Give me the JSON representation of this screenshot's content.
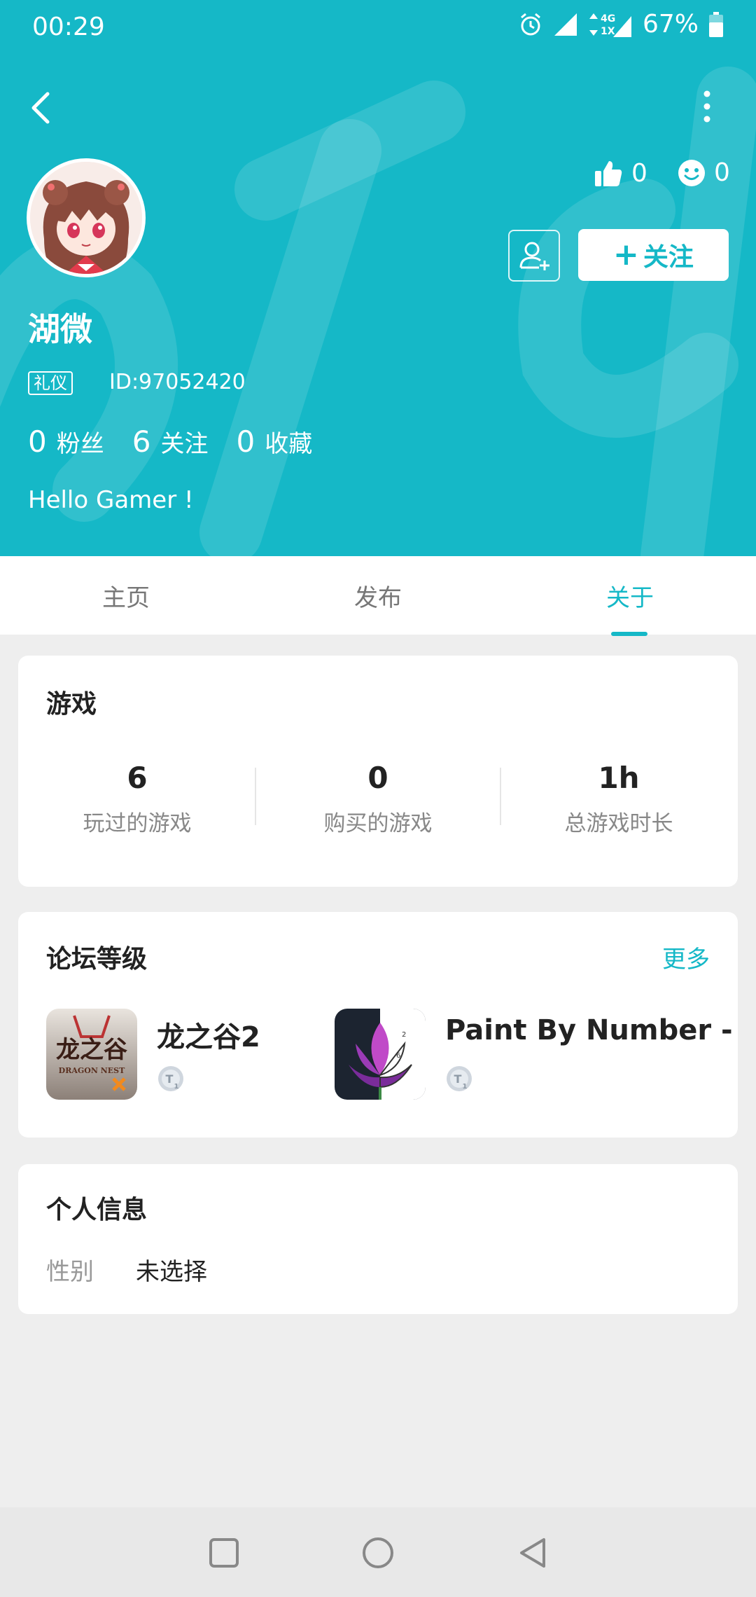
{
  "status_bar": {
    "time": "00:29",
    "network": "4G 1X",
    "battery": "67%",
    "icons": [
      "alarm-icon",
      "signal-icon",
      "network-icon",
      "battery-icon"
    ]
  },
  "colors": {
    "accent": "#15b8c7",
    "header_bg": "#15b8c7",
    "page_bg": "#eeeeee"
  },
  "header": {
    "back_icon": "back-arrow-icon",
    "more_icon": "more-vertical-icon",
    "likes": "0",
    "smiles": "0",
    "follow_label": "关注",
    "username": "湖微",
    "badge": "礼仪",
    "user_id": "ID:97052420",
    "counts": [
      {
        "num": "0",
        "label": "粉丝"
      },
      {
        "num": "6",
        "label": "关注"
      },
      {
        "num": "0",
        "label": "收藏"
      }
    ],
    "bio": "Hello Gamer !"
  },
  "tabs": [
    {
      "label": "主页",
      "active": false
    },
    {
      "label": "发布",
      "active": false
    },
    {
      "label": "关于",
      "active": true
    }
  ],
  "games": {
    "title": "游戏",
    "stats": [
      {
        "value": "6",
        "label": "玩过的游戏"
      },
      {
        "value": "0",
        "label": "购买的游戏"
      },
      {
        "value": "1h",
        "label": "总游戏时长"
      }
    ]
  },
  "forum": {
    "title": "论坛等级",
    "more": "更多",
    "items": [
      {
        "name": "龙之谷2",
        "icon_text": "龙之谷",
        "icon_subtext": "DRAGON NEST",
        "icon": "dragon-nest-app-icon"
      },
      {
        "name": "Paint By Number - Free",
        "icon": "paint-by-number-app-icon"
      }
    ]
  },
  "personal": {
    "title": "个人信息",
    "rows": [
      {
        "key": "性别",
        "value": "未选择"
      }
    ]
  },
  "navbar": {
    "icons": [
      "recents-square-icon",
      "home-circle-icon",
      "back-triangle-icon"
    ]
  }
}
